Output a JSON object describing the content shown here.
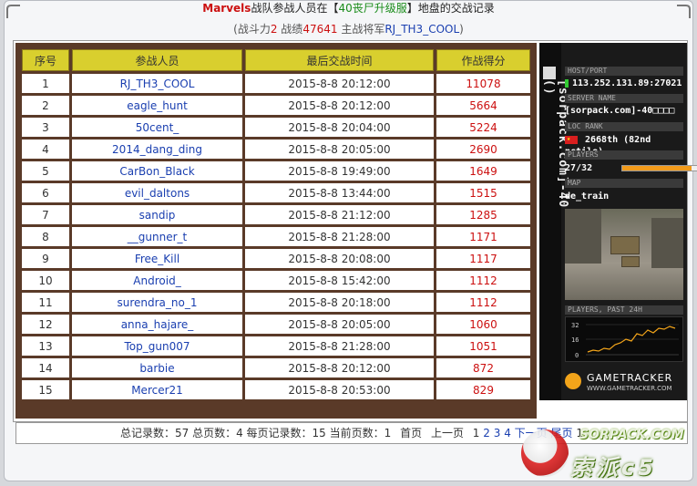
{
  "header": {
    "clan": "Marvels",
    "title_mid": "战队参战人员在【",
    "server": "40丧尸升级服",
    "title_end": "】地盘的交战记录",
    "sub_open": "(战斗力",
    "power": "2",
    "sub_record": " 战绩",
    "record": "47641",
    "sub_general": " 主战将军",
    "general": "RJ_TH3_COOL",
    "sub_close": ")"
  },
  "table": {
    "columns": [
      "序号",
      "参战人员",
      "最后交战时间",
      "作战得分"
    ],
    "rows": [
      {
        "no": "1",
        "name": "RJ_TH3_COOL",
        "time": "2015-8-8 20:12:00",
        "score": "11078"
      },
      {
        "no": "2",
        "name": "eagle_hunt",
        "time": "2015-8-8 20:12:00",
        "score": "5664"
      },
      {
        "no": "3",
        "name": "50cent_",
        "time": "2015-8-8 20:04:00",
        "score": "5224"
      },
      {
        "no": "4",
        "name": "2014_dang_ding",
        "time": "2015-8-8 20:05:00",
        "score": "2690"
      },
      {
        "no": "5",
        "name": "CarBon_Black",
        "time": "2015-8-8 19:49:00",
        "score": "1649"
      },
      {
        "no": "6",
        "name": "evil_daltons",
        "time": "2015-8-8 13:44:00",
        "score": "1515"
      },
      {
        "no": "7",
        "name": "sandip",
        "time": "2015-8-8 21:12:00",
        "score": "1285"
      },
      {
        "no": "8",
        "name": "__gunner_t",
        "time": "2015-8-8 21:28:00",
        "score": "1171"
      },
      {
        "no": "9",
        "name": "Free_Kill",
        "time": "2015-8-8 20:08:00",
        "score": "1117"
      },
      {
        "no": "10",
        "name": "Android_",
        "time": "2015-8-8 15:42:00",
        "score": "1112"
      },
      {
        "no": "11",
        "name": "surendra_no_1",
        "time": "2015-8-8 20:18:00",
        "score": "1112"
      },
      {
        "no": "12",
        "name": "anna_hajare_",
        "time": "2015-8-8 20:05:00",
        "score": "1060"
      },
      {
        "no": "13",
        "name": "Top_gun007",
        "time": "2015-8-8 21:28:00",
        "score": "1051"
      },
      {
        "no": "14",
        "name": "barbie",
        "time": "2015-8-8 20:12:00",
        "score": "872"
      },
      {
        "no": "15",
        "name": "Mercer21",
        "time": "2015-8-8 20:53:00",
        "score": "829"
      }
    ]
  },
  "pagination": {
    "summary": "总记录数：57 总页数：4 每页记录数：15 当前页数：1",
    "first": "首页",
    "prev": "上一页",
    "pages": [
      "1",
      "2",
      "3",
      "4"
    ],
    "next": "下一页",
    "last": "尾页",
    "jump_value": "1"
  },
  "gametracker": {
    "side_text": "[sorpack.com]-40",
    "side_text2": "()",
    "host_label": "HOST/PORT",
    "host_value": "113.252.131.89:27021",
    "name_label": "SERVER NAME",
    "name_value": "[sorpack.com]-40□□□□",
    "rank_label": "LOC   RANK",
    "rank_value": "2668th (82nd pctile)",
    "players_label": "PLAYERS",
    "players_value": "27/32",
    "players_fill": 0.84,
    "map_label": "MAP",
    "map_value": "de_train",
    "graph_label": "PLAYERS, PAST 24H",
    "graph_ticks": [
      "32",
      "16",
      "0"
    ],
    "logo_main": "GAMETRACKER",
    "logo_sub": "WWW.GAMETRACKER.COM"
  },
  "watermark": {
    "site": "SORPACK.COM",
    "cn": "索派c5"
  }
}
